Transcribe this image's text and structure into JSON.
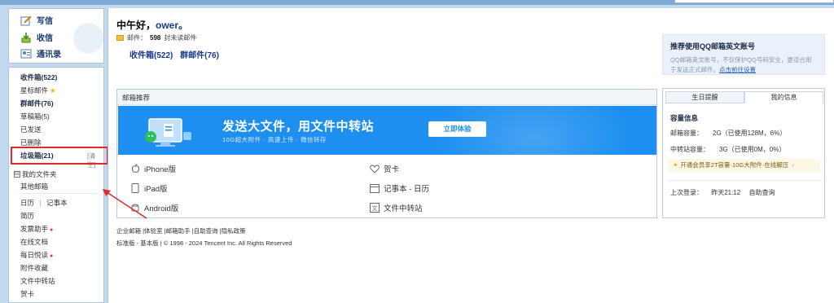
{
  "sidebar": {
    "quick": [
      {
        "label": "写信",
        "icon": "pen-paper-icon"
      },
      {
        "label": "收信",
        "icon": "inbox-icon"
      },
      {
        "label": "通讯录",
        "icon": "contacts-icon"
      }
    ],
    "folders": [
      {
        "label": "收件箱(522)",
        "bold": true
      },
      {
        "label": "星标邮件",
        "star": true
      },
      {
        "label": "群邮件(76)",
        "bold": true
      },
      {
        "label": "草稿箱(5)"
      },
      {
        "label": "已发送"
      },
      {
        "label": "已删除"
      },
      {
        "label": "垃圾箱(21)",
        "bold": true
      }
    ],
    "clean_label": "[清空]",
    "my_folders_label": "我的文件夹",
    "my_folders_toggle": "⊟",
    "other_mail": "其他邮箱",
    "calendar": "日历",
    "notes": "记事本",
    "tools": [
      {
        "label": "简历"
      },
      {
        "label": "发票助手",
        "dot": true
      },
      {
        "label": "在线文档"
      },
      {
        "label": "每日悦读",
        "dot": true
      },
      {
        "label": "附件收藏"
      },
      {
        "label": "文件中转站"
      },
      {
        "label": "贺卡"
      }
    ]
  },
  "main": {
    "greeting": "中午好，",
    "username": "ower。",
    "mail_label": "邮件：",
    "unread_count": "598",
    "unread_suffix": "封未读邮件",
    "inbox_link": "收件箱(522)",
    "group_link": "群邮件(76)"
  },
  "recommend": {
    "title": "推荐使用QQ邮箱英文账号",
    "body": "QQ邮箱英文账号，不仅保护QQ号码安全，更适合用于发送正式邮件。",
    "link": "点击前往设置"
  },
  "card": {
    "title": "邮箱推荐",
    "banner_title": "发送大文件，用文件中转站",
    "banner_sub": "10G超大附件 · 高速上传 · 微信转存",
    "banner_button": "立即体验",
    "banner_color": "#1d8ff0",
    "apps": [
      {
        "label": "iPhone版",
        "icon": "apple-icon"
      },
      {
        "label": "贺卡",
        "icon": "heart-icon"
      },
      {
        "label": "iPad版",
        "icon": "tablet-icon"
      },
      {
        "label": "记事本 - 日历",
        "icon": "calendar-icon"
      },
      {
        "label": "Android版",
        "icon": "android-icon"
      },
      {
        "label": "文件中转站",
        "icon": "file-transfer-icon"
      }
    ]
  },
  "info": {
    "tabs": [
      "生日提醒",
      "我的信息"
    ],
    "capacity_title": "容量信息",
    "mailbox_cap_label": "邮箱容量：",
    "mailbox_cap_value": "2G（已使用128M，6%）",
    "transfer_cap_label": "中转站容量：",
    "transfer_cap_value": "3G（已使用0M，0%）",
    "promo": "开通会员享2T容量·10G大附件·在线解压",
    "promo_arrow": "›",
    "last_login_label": "上次登录：",
    "last_login_time": "昨天21:12",
    "self_query": "自助查询"
  },
  "footer": {
    "links": [
      "企业邮箱",
      "体验室",
      "邮箱助手",
      "自助查询",
      "隐私政策"
    ],
    "copyright": "标准版 - 基本版 | © 1998 - 2024 Tencent Inc. All Rights Reserved"
  },
  "colors": {
    "accent": "#1d8ff0",
    "link": "#1a3a8b",
    "highlight_box": "#e02a2a",
    "bg": "#c3d9ef"
  }
}
